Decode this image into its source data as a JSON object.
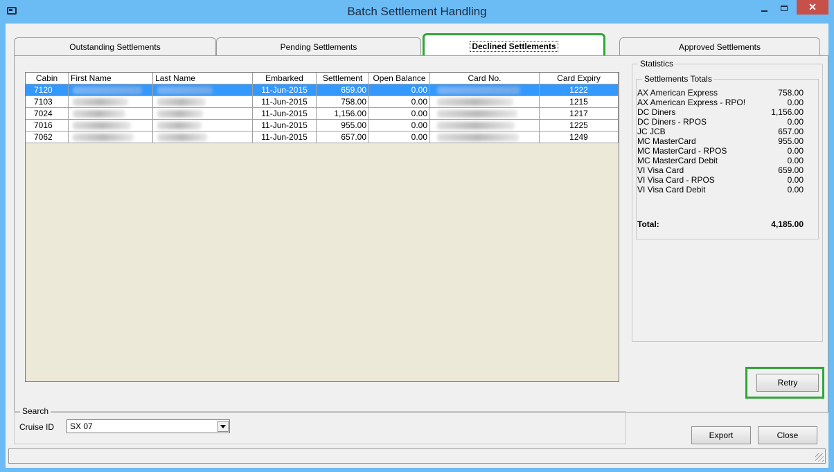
{
  "window": {
    "title": "Batch Settlement Handling",
    "close_glyph": "✕"
  },
  "tabs": [
    {
      "label": "Outstanding Settlements"
    },
    {
      "label": "Pending Settlements"
    },
    {
      "label": "Declined Settlements"
    },
    {
      "label": "Approved Settlements"
    }
  ],
  "grid": {
    "columns": [
      "Cabin",
      "First Name",
      "Last Name",
      "Embarked",
      "Settlement",
      "Open Balance",
      "Card No.",
      "Card Expiry"
    ],
    "rows": [
      {
        "cabin": "7120",
        "embarked": "11-Jun-2015",
        "settlement": "659.00",
        "open_balance": "0.00",
        "card_expiry": "1222",
        "selected": true
      },
      {
        "cabin": "7103",
        "embarked": "11-Jun-2015",
        "settlement": "758.00",
        "open_balance": "0.00",
        "card_expiry": "1215",
        "selected": false
      },
      {
        "cabin": "7024",
        "embarked": "11-Jun-2015",
        "settlement": "1,156.00",
        "open_balance": "0.00",
        "card_expiry": "1217",
        "selected": false
      },
      {
        "cabin": "7016",
        "embarked": "11-Jun-2015",
        "settlement": "955.00",
        "open_balance": "0.00",
        "card_expiry": "1225",
        "selected": false
      },
      {
        "cabin": "7062",
        "embarked": "11-Jun-2015",
        "settlement": "657.00",
        "open_balance": "0.00",
        "card_expiry": "1249",
        "selected": false
      }
    ]
  },
  "statistics": {
    "legend": "Statistics",
    "totals_legend": "Settlements Totals",
    "items": [
      {
        "label": "AX  American Express",
        "value": "758.00"
      },
      {
        "label": "AX  American Express - RPO!",
        "value": "0.00"
      },
      {
        "label": "DC  Diners",
        "value": "1,156.00"
      },
      {
        "label": "DC  Diners - RPOS",
        "value": "0.00"
      },
      {
        "label": "JC  JCB",
        "value": "657.00"
      },
      {
        "label": "MC  MasterCard",
        "value": "955.00"
      },
      {
        "label": "MC  MasterCard - RPOS",
        "value": "0.00"
      },
      {
        "label": "MC  MasterCard Debit",
        "value": "0.00"
      },
      {
        "label": "VI  Visa Card",
        "value": "659.00"
      },
      {
        "label": "VI  Visa Card - RPOS",
        "value": "0.00"
      },
      {
        "label": "VI  Visa Card Debit",
        "value": "0.00"
      }
    ],
    "total_label": "Total:",
    "total_value": "4,185.00"
  },
  "buttons": {
    "retry": "Retry",
    "export": "Export",
    "close": "Close"
  },
  "search": {
    "legend": "Search",
    "cruise_label": "Cruise ID",
    "cruise_value": "SX 07"
  }
}
